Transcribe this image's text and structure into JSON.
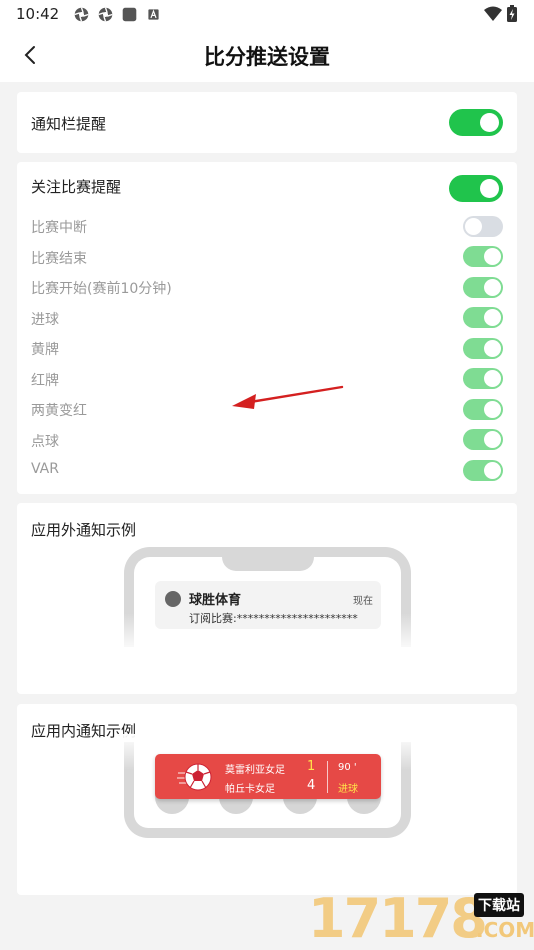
{
  "status_bar": {
    "time": "10:42",
    "icons": [
      "aperture-icon",
      "aperture-icon",
      "square-app-icon",
      "a-box-icon"
    ],
    "right_icons": [
      "wifi-icon",
      "battery-charging-icon"
    ]
  },
  "header": {
    "title": "比分推送设置",
    "back_icon": "chevron-left-icon"
  },
  "notification_bar": {
    "label": "通知栏提醒",
    "enabled": true
  },
  "follow_reminder": {
    "label": "关注比赛提醒",
    "enabled": true,
    "items": [
      {
        "label": "比赛中断",
        "enabled": false
      },
      {
        "label": "比赛结束",
        "enabled": true
      },
      {
        "label": "比赛开始(赛前10分钟)",
        "enabled": true
      },
      {
        "label": "进球",
        "enabled": true
      },
      {
        "label": "黄牌",
        "enabled": true
      },
      {
        "label": "红牌",
        "enabled": true
      },
      {
        "label": "两黄变红",
        "enabled": true
      },
      {
        "label": "点球",
        "enabled": true
      },
      {
        "label": "VAR",
        "enabled": true
      }
    ]
  },
  "outside_example": {
    "title": "应用外通知示例",
    "app_name": "球胜体育",
    "time": "现在",
    "text": "订阅比赛:**********************"
  },
  "inside_example": {
    "title": "应用内通知示例",
    "home_team": "莫雷利亚女足",
    "away_team": "帕丘卡女足",
    "home_score": "1",
    "away_score": "4",
    "minute": "90 '",
    "event": "进球"
  },
  "watermark": {
    "number": "17178",
    "badge": "下载站",
    "suffix": ".COM"
  },
  "colors": {
    "toggle_on": "#20c44c",
    "toggle_on_light": "#7fdc93",
    "toggle_off": "#d9dde3",
    "banner_red": "#e64946",
    "annotation_arrow": "#d42020"
  }
}
